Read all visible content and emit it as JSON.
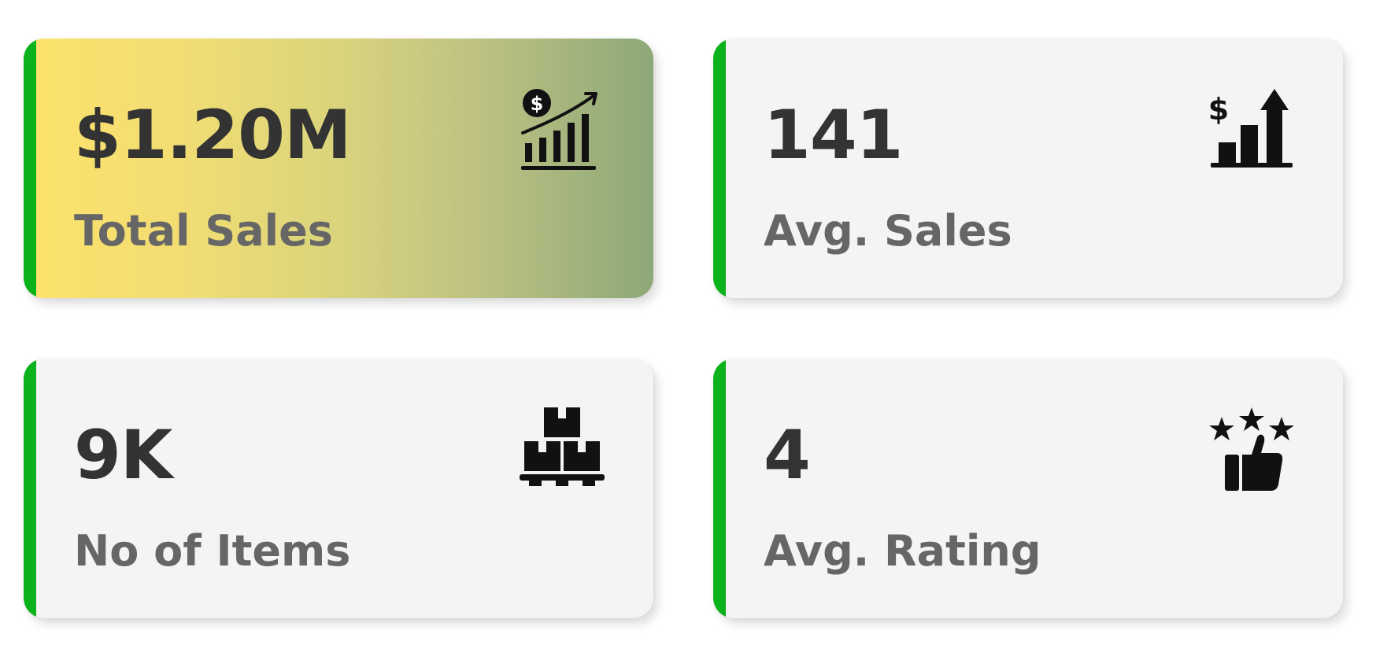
{
  "cards": [
    {
      "value": "$1.20M",
      "label": "Total Sales",
      "icon": "sales-growth-chart-icon"
    },
    {
      "value": "141",
      "label": "Avg. Sales",
      "icon": "sales-bar-arrow-icon"
    },
    {
      "value": "9K",
      "label": "No of Items",
      "icon": "boxes-pallet-icon"
    },
    {
      "value": "4",
      "label": "Avg. Rating",
      "icon": "stars-thumbs-up-icon"
    }
  ],
  "colors": {
    "accent_bar": "#0bb21b",
    "card_background": "#f4f4f4",
    "highlight_gradient_start": "#fde36c",
    "highlight_gradient_end": "#8da878",
    "value_text": "#333333",
    "label_text": "#666666"
  }
}
